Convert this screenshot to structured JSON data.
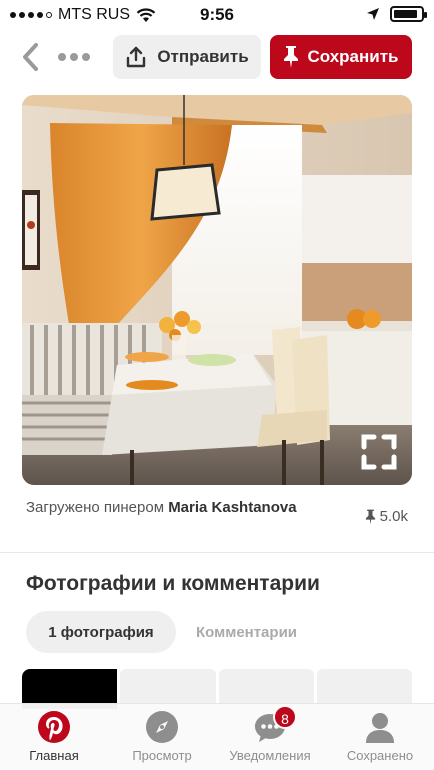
{
  "status_bar": {
    "carrier": "MTS RUS",
    "time": "9:56",
    "signal_bars": 4,
    "battery_level": 0.9
  },
  "topbar": {
    "back_icon": "chevron-left-icon",
    "more_icon": "more-dots-icon",
    "send_label": "Отправить",
    "save_label": "Сохранить",
    "save_color": "#bd081c"
  },
  "pin": {
    "expand_icon": "fullscreen-icon",
    "uploaded_by_prefix": "Загружено пинером",
    "uploader_name": "Maria Kashtanova",
    "save_count": "5.0k"
  },
  "comments_section": {
    "title": "Фотографии и комментарии",
    "tabs": [
      {
        "label": "1 фотография",
        "active": true
      },
      {
        "label": "Комментарии",
        "active": false
      }
    ]
  },
  "tabbar": {
    "items": [
      {
        "label": "Главная",
        "icon": "pinterest-logo-icon",
        "active": true
      },
      {
        "label": "Просмотр",
        "icon": "compass-icon",
        "active": false
      },
      {
        "label": "Уведомления",
        "icon": "chat-bubble-icon",
        "active": false,
        "badge": "8"
      },
      {
        "label": "Сохранено",
        "icon": "profile-icon",
        "active": false
      }
    ]
  }
}
